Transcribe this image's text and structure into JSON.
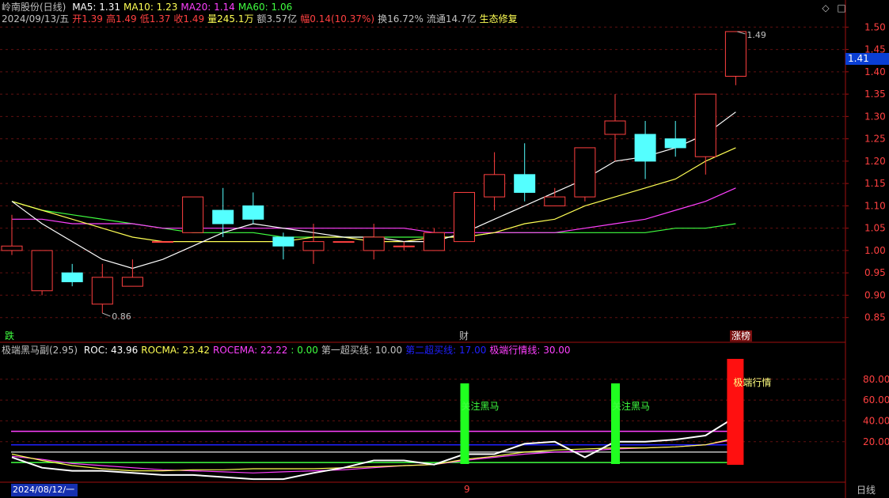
{
  "header": {
    "stock_name": "岭南股份(日线)",
    "ma": [
      {
        "label": "MA5: 1.31",
        "color": "#ffffff"
      },
      {
        "label": "MA10: 1.23",
        "color": "#ffff54"
      },
      {
        "label": "MA20: 1.14",
        "color": "#ff40ff"
      },
      {
        "label": "MA60: 1.06",
        "color": "#40ff40"
      }
    ],
    "quote": [
      {
        "text": "2024/09/13/五",
        "color": "#c0c0c0"
      },
      {
        "text": "开1.39",
        "color": "#ff4040"
      },
      {
        "text": "高1.49",
        "color": "#ff4040"
      },
      {
        "text": "低1.37",
        "color": "#ff4040"
      },
      {
        "text": "收1.49",
        "color": "#ff4040"
      },
      {
        "text": "量245.1万",
        "color": "#ffff54"
      },
      {
        "text": "额3.57亿",
        "color": "#c0c0c0"
      },
      {
        "text": "幅0.14(10.37%)",
        "color": "#ff4040"
      },
      {
        "text": "换16.72%",
        "color": "#c0c0c0"
      },
      {
        "text": "流通14.7亿",
        "color": "#c0c0c0"
      },
      {
        "text": "生态修复",
        "color": "#ffff54"
      }
    ]
  },
  "controls": {
    "settings_icon": "◇",
    "close_icon": "□"
  },
  "price_axis": {
    "ticks": [
      "1.50",
      "1.45",
      "1.40",
      "1.35",
      "1.30",
      "1.25",
      "1.20",
      "1.15",
      "1.10",
      "1.05",
      "1.00",
      "0.95",
      "0.90",
      "0.85"
    ],
    "current": "1.41"
  },
  "markers": {
    "high_label": "1.49",
    "low_label": "0.86",
    "event_left": "跌",
    "event_mid": "财",
    "event_right": "涨榜"
  },
  "indicator": {
    "title": "极端黑马副(2.95)",
    "items": [
      {
        "text": "ROC: 43.96",
        "color": "#ffffff"
      },
      {
        "text": "ROCMA: 23.42",
        "color": "#ffff54"
      },
      {
        "text": "ROCEMA: 22.22",
        "color": "#ff40ff"
      },
      {
        "text": ": 0.00",
        "color": "#40ff40"
      },
      {
        "text": "第一超买线: 10.00",
        "color": "#c0c0c0"
      },
      {
        "text": "第二超买线: 17.00",
        "color": "#2020ff"
      },
      {
        "text": "极端行情线: 30.00",
        "color": "#ff40ff"
      }
    ],
    "ticks": [
      "80.00",
      "60.00",
      "40.00",
      "20.00"
    ],
    "signal_label": "关注黑马",
    "extreme_label": "极端行情"
  },
  "footer": {
    "date_tag": "2024/08/12/一",
    "month_marker": "9",
    "period": "日线"
  },
  "chart_data": {
    "type": "candlestick",
    "ylim": [
      0.83,
      1.52
    ],
    "candles": [
      {
        "o": 1.0,
        "c": 1.01,
        "h": 1.08,
        "l": 0.99
      },
      {
        "o": 0.91,
        "c": 1.0,
        "h": 1.0,
        "l": 0.9
      },
      {
        "o": 0.95,
        "c": 0.93,
        "h": 0.97,
        "l": 0.92
      },
      {
        "o": 0.88,
        "c": 0.94,
        "h": 0.97,
        "l": 0.86
      },
      {
        "o": 0.92,
        "c": 0.94,
        "h": 0.98,
        "l": 0.92
      },
      {
        "o": 1.02,
        "c": 1.02,
        "h": 1.02,
        "l": 1.02
      },
      {
        "o": 1.04,
        "c": 1.12,
        "h": 1.12,
        "l": 1.04
      },
      {
        "o": 1.09,
        "c": 1.06,
        "h": 1.14,
        "l": 1.03
      },
      {
        "o": 1.1,
        "c": 1.07,
        "h": 1.13,
        "l": 1.06
      },
      {
        "o": 1.03,
        "c": 1.01,
        "h": 1.04,
        "l": 0.98
      },
      {
        "o": 1.0,
        "c": 1.02,
        "h": 1.06,
        "l": 0.97
      },
      {
        "o": 1.02,
        "c": 1.02,
        "h": 1.02,
        "l": 1.02
      },
      {
        "o": 1.0,
        "c": 1.03,
        "h": 1.06,
        "l": 0.98
      },
      {
        "o": 1.01,
        "c": 1.01,
        "h": 1.02,
        "l": 1.0
      },
      {
        "o": 1.0,
        "c": 1.04,
        "h": 1.05,
        "l": 1.0
      },
      {
        "o": 1.02,
        "c": 1.13,
        "h": 1.13,
        "l": 1.02
      },
      {
        "o": 1.12,
        "c": 1.17,
        "h": 1.22,
        "l": 1.09
      },
      {
        "o": 1.17,
        "c": 1.13,
        "h": 1.24,
        "l": 1.11
      },
      {
        "o": 1.1,
        "c": 1.12,
        "h": 1.14,
        "l": 1.1
      },
      {
        "o": 1.12,
        "c": 1.23,
        "h": 1.23,
        "l": 1.11
      },
      {
        "o": 1.26,
        "c": 1.29,
        "h": 1.35,
        "l": 1.2
      },
      {
        "o": 1.26,
        "c": 1.2,
        "h": 1.29,
        "l": 1.16
      },
      {
        "o": 1.25,
        "c": 1.23,
        "h": 1.29,
        "l": 1.21
      },
      {
        "o": 1.21,
        "c": 1.35,
        "h": 1.35,
        "l": 1.17
      },
      {
        "o": 1.39,
        "c": 1.49,
        "h": 1.49,
        "l": 1.37
      }
    ],
    "ma5": [
      1.11,
      1.06,
      1.02,
      0.98,
      0.96,
      0.98,
      1.01,
      1.04,
      1.06,
      1.05,
      1.04,
      1.03,
      1.03,
      1.02,
      1.02,
      1.04,
      1.07,
      1.1,
      1.13,
      1.16,
      1.2,
      1.21,
      1.23,
      1.26,
      1.31
    ],
    "ma10": [
      1.11,
      1.09,
      1.07,
      1.05,
      1.03,
      1.02,
      1.02,
      1.02,
      1.02,
      1.02,
      1.03,
      1.03,
      1.02,
      1.02,
      1.03,
      1.03,
      1.04,
      1.06,
      1.07,
      1.1,
      1.12,
      1.14,
      1.16,
      1.2,
      1.23
    ],
    "ma20": [
      1.07,
      1.07,
      1.06,
      1.06,
      1.06,
      1.05,
      1.05,
      1.05,
      1.05,
      1.05,
      1.05,
      1.05,
      1.05,
      1.05,
      1.04,
      1.04,
      1.04,
      1.04,
      1.04,
      1.05,
      1.06,
      1.07,
      1.09,
      1.11,
      1.14
    ],
    "ma60": [
      1.11,
      1.09,
      1.08,
      1.07,
      1.06,
      1.05,
      1.04,
      1.04,
      1.04,
      1.03,
      1.03,
      1.03,
      1.03,
      1.03,
      1.03,
      1.03,
      1.04,
      1.04,
      1.04,
      1.04,
      1.04,
      1.04,
      1.05,
      1.05,
      1.06
    ],
    "roc": [
      5,
      -5,
      -8,
      -8,
      -10,
      -12,
      -12,
      -14,
      -16,
      -16,
      -10,
      -5,
      2,
      2,
      -2,
      8,
      8,
      18,
      20,
      5,
      20,
      20,
      22,
      26,
      43.96
    ],
    "rocma": [
      8,
      2,
      -3,
      -6,
      -8,
      -8,
      -7,
      -7,
      -6,
      -6,
      -6,
      -5,
      -4,
      -3,
      -2,
      3,
      6,
      10,
      12,
      13,
      14,
      14,
      15,
      17,
      23.42
    ],
    "rocema": [
      6,
      3,
      -1,
      -3,
      -5,
      -7,
      -8,
      -9,
      -10,
      -9,
      -8,
      -7,
      -5,
      -3,
      -2,
      2,
      5,
      8,
      10,
      11,
      13,
      14,
      15,
      17,
      22.22
    ],
    "overbought1": 10,
    "overbought2": 17,
    "extreme_line": 30,
    "signals": [
      15,
      20
    ],
    "extreme_bar": 24,
    "ind_ylim": [
      -25,
      95
    ]
  }
}
